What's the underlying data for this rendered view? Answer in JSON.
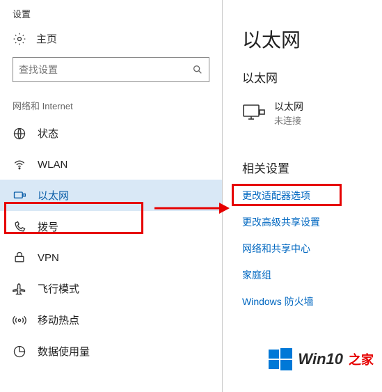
{
  "app_title": "设置",
  "home_label": "主页",
  "search": {
    "placeholder": "查找设置"
  },
  "section_label": "网络和 Internet",
  "nav": {
    "status": "状态",
    "wlan": "WLAN",
    "ethernet": "以太网",
    "dialup": "拨号",
    "vpn": "VPN",
    "airplane": "飞行模式",
    "hotspot": "移动热点",
    "datausage": "数据使用量"
  },
  "right": {
    "title": "以太网",
    "subtitle": "以太网",
    "eth_name": "以太网",
    "eth_status": "未连接",
    "related_title": "相关设置",
    "links": {
      "adapter": "更改适配器选项",
      "sharing": "更改高级共享设置",
      "center": "网络和共享中心",
      "homegroup": "家庭组",
      "firewall": "Windows 防火墙"
    }
  },
  "watermark": {
    "text_a": "Win10",
    "text_b": "之家"
  }
}
